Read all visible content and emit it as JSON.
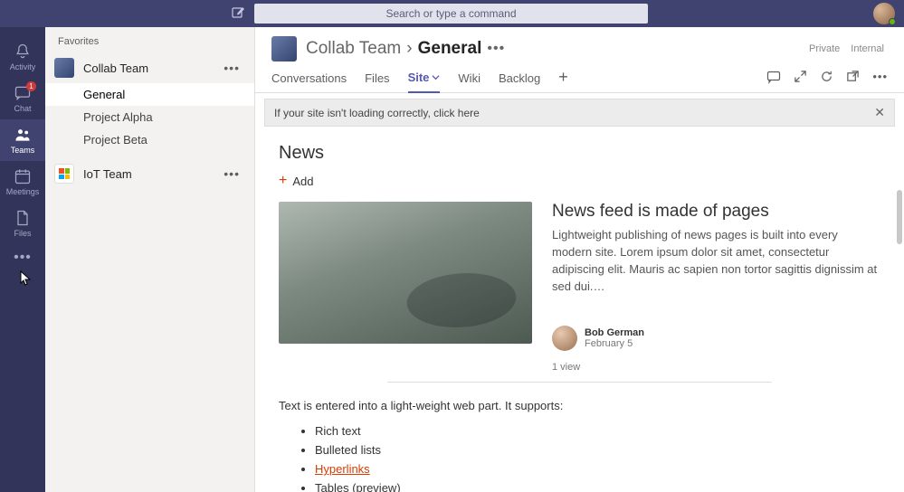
{
  "titlebar": {
    "search_placeholder": "Search or type a command"
  },
  "rail": {
    "items": [
      {
        "key": "activity",
        "label": "Activity"
      },
      {
        "key": "chat",
        "label": "Chat",
        "badge": "1"
      },
      {
        "key": "teams",
        "label": "Teams",
        "active": true
      },
      {
        "key": "meetings",
        "label": "Meetings"
      },
      {
        "key": "files",
        "label": "Files"
      }
    ]
  },
  "sidebar": {
    "header": "Favorites",
    "teams": [
      {
        "name": "Collab Team",
        "channels": [
          {
            "name": "General",
            "selected": true
          },
          {
            "name": "Project Alpha"
          },
          {
            "name": "Project Beta"
          }
        ]
      },
      {
        "name": "IoT Team",
        "icon": "ms",
        "channels": []
      }
    ]
  },
  "header": {
    "team": "Collab Team",
    "channel": "General",
    "badges": [
      "Private",
      "Internal"
    ]
  },
  "tabs": {
    "items": [
      "Conversations",
      "Files",
      "Site",
      "Wiki",
      "Backlog"
    ],
    "active": "Site"
  },
  "banner": {
    "text": "If your site isn't loading correctly, click here"
  },
  "news": {
    "heading": "News",
    "add_label": "Add",
    "article": {
      "title": "News feed is made of pages",
      "desc": "Lightweight publishing of news pages is built into every modern site. Lorem ipsum dolor sit amet, consectetur adipiscing elit. Mauris ac sapien non tortor sagittis dignissim at sed dui.…",
      "author": "Bob German",
      "date": "February 5",
      "views": "1 view"
    },
    "text_intro": "Text is entered into a light-weight web part. It supports:",
    "features": [
      "Rich text",
      "Bulleted lists",
      "Hyperlinks",
      "Tables (preview)"
    ]
  }
}
